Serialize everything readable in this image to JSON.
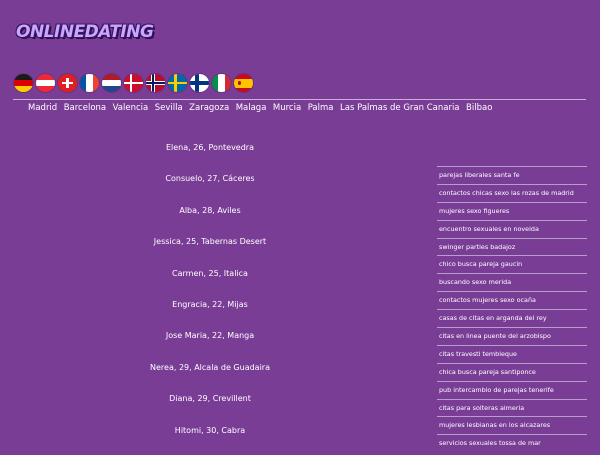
{
  "logo": "ONLINEDATING",
  "flags": [
    {
      "country": "germany",
      "icon": "germany-flag-icon"
    },
    {
      "country": "austria",
      "icon": "austria-flag-icon"
    },
    {
      "country": "switzerland",
      "icon": "switzerland-flag-icon"
    },
    {
      "country": "france",
      "icon": "france-flag-icon"
    },
    {
      "country": "netherlands",
      "icon": "netherlands-flag-icon"
    },
    {
      "country": "denmark",
      "icon": "denmark-flag-icon"
    },
    {
      "country": "norway",
      "icon": "norway-flag-icon"
    },
    {
      "country": "sweden",
      "icon": "sweden-flag-icon"
    },
    {
      "country": "finland",
      "icon": "finland-flag-icon"
    },
    {
      "country": "italy",
      "icon": "italy-flag-icon"
    },
    {
      "country": "spain",
      "icon": "spain-flag-icon"
    }
  ],
  "cities": [
    "Madrid",
    "Barcelona",
    "Valencia",
    "Sevilla",
    "Zaragoza",
    "Malaga",
    "Murcia",
    "Palma",
    "Las Palmas de Gran Canaria",
    "Bilbao"
  ],
  "people": [
    "Elena, 26, Pontevedra",
    "Consuelo, 27, Cáceres",
    "Alba, 28, Aviles",
    "Jessica, 25, Tabernas Desert",
    "Carmen, 25, Italica",
    "Engracia, 22, Mijas",
    "Jose Maria, 22, Manga",
    "Nerea, 29, Alcala de Guadaira",
    "Diana, 29, Crevillent",
    "Hitomi, 30, Cabra"
  ],
  "links": [
    "parejas liberales santa fe",
    "contactos chicas sexo las rozas de madrid",
    "mujeres sexo figueres",
    "encuentro sexuales en novelda",
    "swinger parties badajoz",
    "chico busca pareja gaucin",
    "buscando sexo merida",
    "contactos mujeres sexo ocaña",
    "casas de citas en arganda del rey",
    "citas en linea puente del arzobispo",
    "citas travesti tembleque",
    "chica busca pareja santiponce",
    "pub intercambio de parejas tenerife",
    "citas para solteras almeria",
    "mujeres lesbianas en los alcazares",
    "servicios sexuales tossa de mar"
  ],
  "colors": {
    "background": "#7a3d96",
    "text": "#ffffff",
    "divider": "#c8b0d6"
  }
}
